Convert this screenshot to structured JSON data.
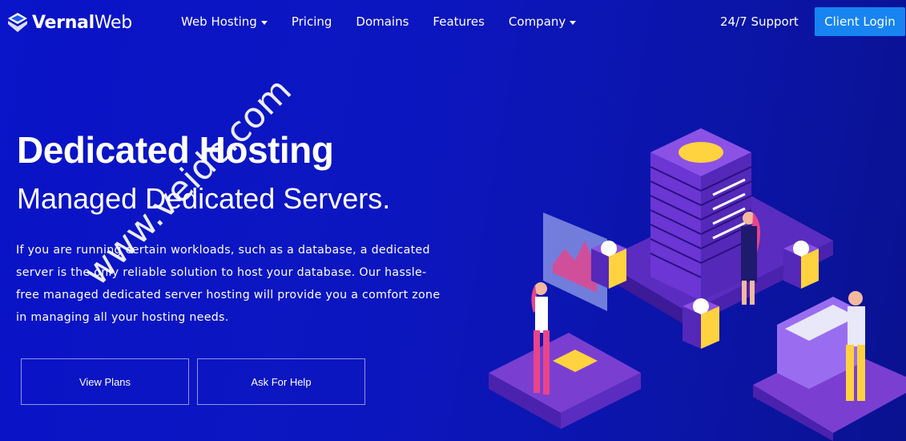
{
  "logo": {
    "brand_bold": "Vernal",
    "brand_light": "Web",
    "icon": "cube-logo-icon"
  },
  "nav": {
    "items": [
      {
        "label": "Web Hosting",
        "dropdown": true
      },
      {
        "label": "Pricing",
        "dropdown": false
      },
      {
        "label": "Domains",
        "dropdown": false
      },
      {
        "label": "Features",
        "dropdown": false
      },
      {
        "label": "Company",
        "dropdown": true
      }
    ],
    "support_label": "24/7 Support",
    "login_label": "Client Login"
  },
  "hero": {
    "title": "Dedicated Hosting",
    "subtitle": "Managed Dedicated Servers.",
    "description": "If you are running certain workloads, such as a database, a dedicated server is the only reliable solution to host your database. Our hassle-free managed dedicated server hosting will provide you a comfort zone in managing all your hosting needs.",
    "btn_plans": "View Plans",
    "btn_help": "Ask For Help"
  },
  "watermark": "www.veidc.com",
  "colors": {
    "accent": "#1784f2",
    "bg_start": "#0a14c8",
    "bg_end": "#0a1290",
    "platform": "#7a3fd1",
    "highlight": "#ffd23f"
  }
}
